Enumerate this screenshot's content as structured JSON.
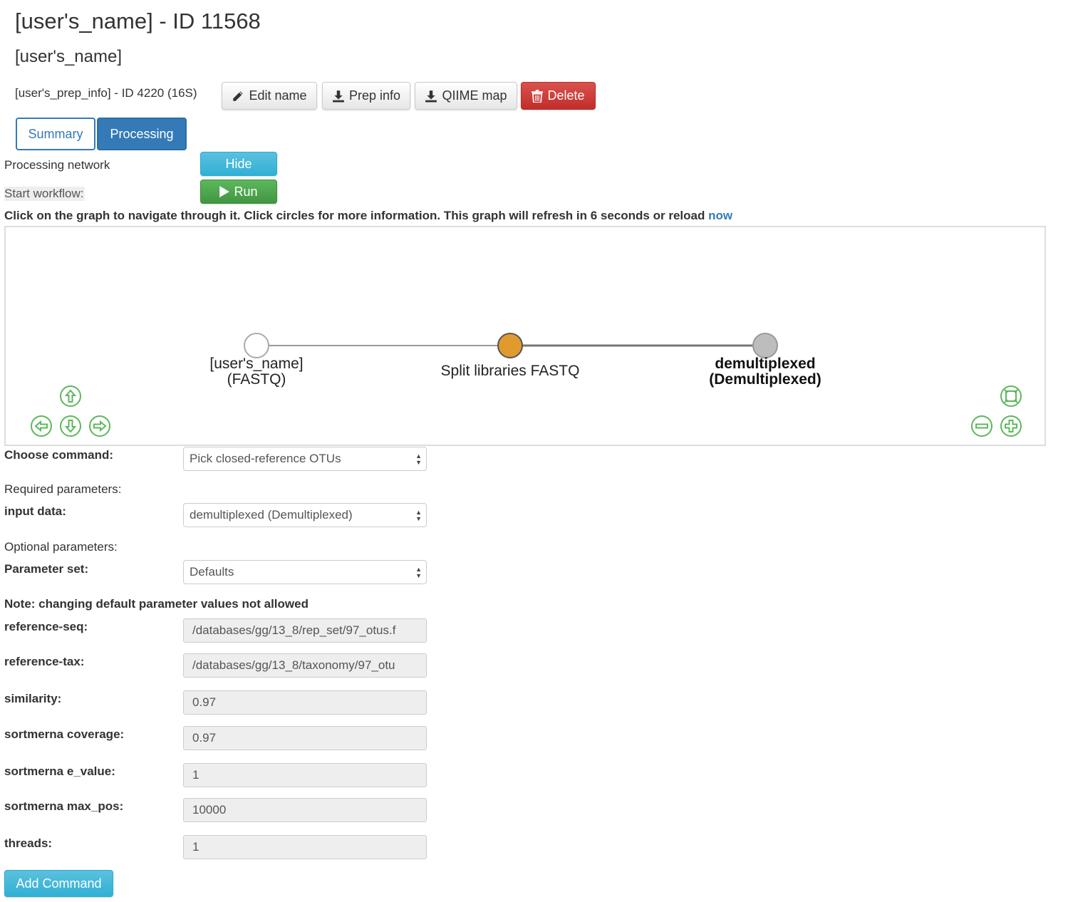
{
  "header": {
    "title": "[user's_name] - ID 11568",
    "subtitle": "[user's_name]",
    "prep_label": "[user's_prep_info] - ID 4220 (16S)"
  },
  "toolbar": {
    "edit_name": "Edit name",
    "prep_info": "Prep info",
    "qiime_map": "QIIME map",
    "delete": "Delete"
  },
  "tabs": {
    "summary": "Summary",
    "processing": "Processing"
  },
  "processing": {
    "network_label": "Processing network",
    "hide_button": "Hide",
    "start_label": "Start workflow:",
    "run_button": "Run",
    "hint_text": "Click on the graph to navigate through it. Click circles for more information. This graph will refresh in 6 seconds or reload ",
    "hint_link": "now"
  },
  "graph": {
    "nodes": [
      {
        "line1": "[user's_name]",
        "line2": "(FASTQ)",
        "color": "#ffffff",
        "bold": false
      },
      {
        "line1": "Split libraries FASTQ",
        "line2": "",
        "color": "#e09a2e",
        "bold": false
      },
      {
        "line1": "demultiplexed",
        "line2": "(Demultiplexed)",
        "color": "#bdbdbd",
        "bold": true
      }
    ],
    "control_color": "#5cb85c",
    "icons": [
      "pan-up-icon",
      "pan-left-icon",
      "pan-down-icon",
      "pan-right-icon",
      "fit-icon",
      "zoom-out-icon",
      "zoom-in-icon"
    ]
  },
  "form": {
    "choose_command_label": "Choose command:",
    "choose_command_value": "Pick closed-reference OTUs",
    "required_label": "Required parameters:",
    "input_data_label": "input data:",
    "input_data_value": "demultiplexed (Demultiplexed)",
    "optional_label": "Optional parameters:",
    "param_set_label": "Parameter set:",
    "param_set_value": "Defaults",
    "note": "Note: changing default parameter values not allowed",
    "params": [
      {
        "label": "reference-seq:",
        "value": "/databases/gg/13_8/rep_set/97_otus.f"
      },
      {
        "label": "reference-tax:",
        "value": "/databases/gg/13_8/taxonomy/97_otu"
      },
      {
        "label": "similarity:",
        "value": "0.97"
      },
      {
        "label": "sortmerna coverage:",
        "value": "0.97"
      },
      {
        "label": "sortmerna e_value:",
        "value": "1"
      },
      {
        "label": "sortmerna max_pos:",
        "value": "10000"
      },
      {
        "label": "threads:",
        "value": "1"
      }
    ],
    "add_command": "Add Command"
  }
}
